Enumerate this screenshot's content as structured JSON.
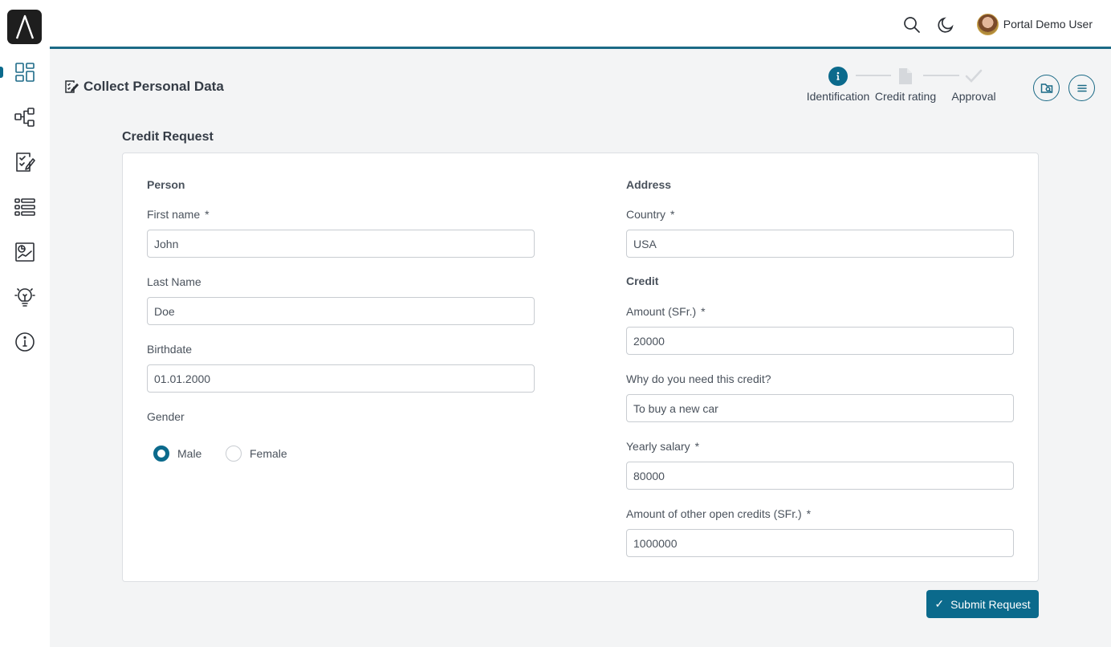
{
  "app": {
    "logo_icon": "axon-ivy-logo",
    "accent_color": "#0b6a8c"
  },
  "sidebar": {
    "items": [
      {
        "icon": "dashboard-icon",
        "active": true
      },
      {
        "icon": "process-icon",
        "active": false
      },
      {
        "icon": "tasks-icon",
        "active": false
      },
      {
        "icon": "cases-icon",
        "active": false
      },
      {
        "icon": "statistics-icon",
        "active": false
      },
      {
        "icon": "ideas-icon",
        "active": false
      },
      {
        "icon": "info-icon",
        "active": false
      }
    ]
  },
  "topbar": {
    "search_icon": "search-icon",
    "theme_icon": "moon-icon",
    "user_name": "Portal Demo User"
  },
  "header": {
    "title": "Collect Personal Data",
    "steps": [
      {
        "label": "Identification",
        "state": "active"
      },
      {
        "label": "Credit rating",
        "state": "pending"
      },
      {
        "label": "Approval",
        "state": "pending"
      }
    ]
  },
  "form": {
    "section_title": "Credit Request",
    "person": {
      "title": "Person",
      "first_name_label": "First name",
      "first_name_value": "John",
      "last_name_label": "Last Name",
      "last_name_value": "Doe",
      "birthdate_label": "Birthdate",
      "birthdate_value": "01.01.2000",
      "gender_label": "Gender",
      "gender_options": [
        "Male",
        "Female"
      ],
      "gender_selected": "Male"
    },
    "address": {
      "title": "Address",
      "country_label": "Country",
      "country_value": "USA"
    },
    "credit": {
      "title": "Credit",
      "amount_label": "Amount (SFr.)",
      "amount_value": "20000",
      "reason_label": "Why do you need this credit?",
      "reason_value": "To buy a new car",
      "salary_label": "Yearly salary",
      "salary_value": "80000",
      "other_credits_label": "Amount of other open credits (SFr.)",
      "other_credits_value": "1000000"
    },
    "required_mark": "*",
    "submit_label": "Submit Request"
  }
}
